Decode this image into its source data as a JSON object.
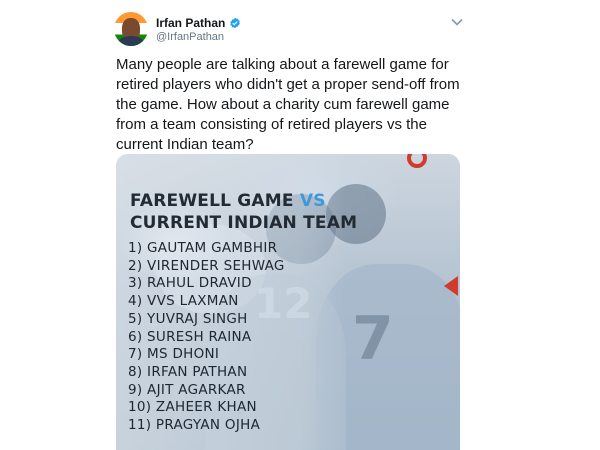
{
  "author": {
    "display_name": "Irfan Pathan",
    "handle": "@IrfanPathan",
    "verified": true
  },
  "tweet": {
    "text": "Many people are talking about a farewell game for retired players who didn't get a proper send-off from the game. How about a charity cum farewell game from a team consisting of retired players vs the current Indian team?"
  },
  "graphic": {
    "title_line1_a": "FAREWELL GAME ",
    "title_line1_b": "VS",
    "title_line2": "CURRENT INDIAN TEAM",
    "players": [
      "1) GAUTAM GAMBHIR",
      "2) VIRENDER SEHWAG",
      "3) RAHUL DRAVID",
      "4) VVS LAXMAN",
      "5) YUVRAJ SINGH",
      "6) SURESH RAINA",
      "7) MS DHONI",
      "8) IRFAN PATHAN",
      "9) AJIT AGARKAR",
      "10) ZAHEER KHAN",
      "11) PRAGYAN OJHA"
    ]
  },
  "colors": {
    "verified_badge": "#1da1f2",
    "vs_accent": "#3f98d9",
    "red_accent": "#d33a2e"
  },
  "icons": {
    "verified": "verified-badge-icon",
    "menu": "chevron-down-icon"
  }
}
